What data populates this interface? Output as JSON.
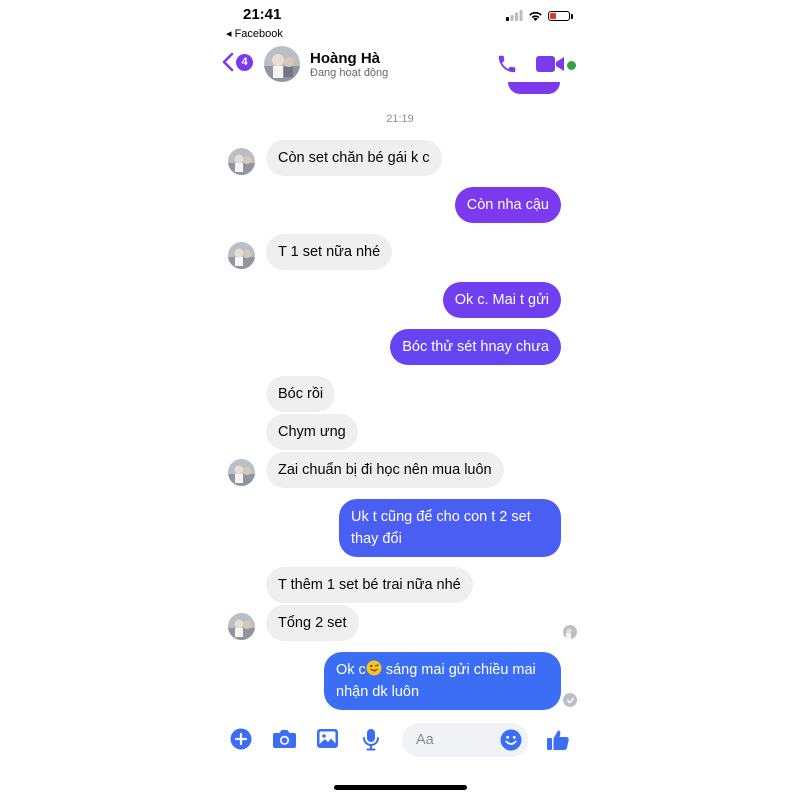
{
  "status_bar": {
    "time": "21:41",
    "back_app": "◂ Facebook"
  },
  "header": {
    "unread_count": "4",
    "contact_name": "Hoàng Hà",
    "contact_status": "Đang hoạt động"
  },
  "conversation": {
    "timestamp": "21:19",
    "messages": [
      {
        "sender": "them",
        "text": "Còn set chăn bé gái k c"
      },
      {
        "sender": "me",
        "text": "Còn nha cậu"
      },
      {
        "sender": "them",
        "text": "T 1 set nữa nhé"
      },
      {
        "sender": "me",
        "text": "Ok c. Mai t gửi"
      },
      {
        "sender": "me",
        "text": "Bóc thử sét hnay chưa"
      },
      {
        "sender": "them",
        "text": "Bóc rồi"
      },
      {
        "sender": "them",
        "text": "Chym ưng"
      },
      {
        "sender": "them",
        "text": "Zai chuẩn bị đi học nên mua luôn"
      },
      {
        "sender": "me",
        "text": "Uk t cũng để cho con t 2 set thay đổi"
      },
      {
        "sender": "them",
        "text": "T thêm 1 set bé trai nữa nhé"
      },
      {
        "sender": "them",
        "text": "Tổng 2 set"
      },
      {
        "sender": "me",
        "text_before_emoji": "Ok c",
        "emoji": "tongue-wink-emoji",
        "text_after_emoji": " sáng mai gửi chiều mai nhận dk luôn"
      }
    ]
  },
  "composer": {
    "placeholder": "Aa"
  },
  "colors": {
    "accent": "#7b3aed",
    "gradient_top": "#7b3aed",
    "gradient_bottom": "#3b6ef5",
    "incoming_bg": "#efefef",
    "blue": "#3b6ef5"
  }
}
